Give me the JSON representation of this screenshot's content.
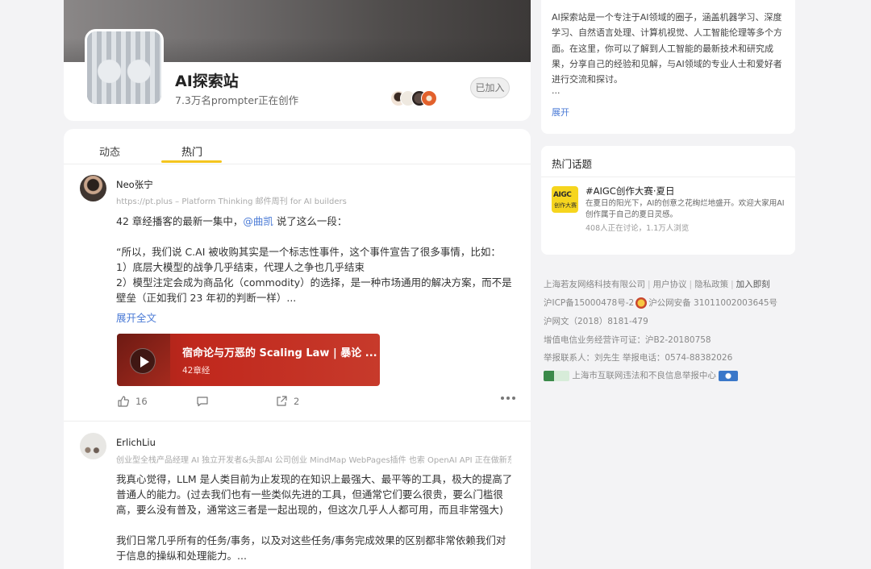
{
  "group": {
    "name": "AI探索站",
    "member_line": "7.3万名prompter正在创作",
    "joined_label": "已加入"
  },
  "tabs": [
    {
      "label": "动态"
    },
    {
      "label": "热门"
    }
  ],
  "posts": [
    {
      "author": "Neo张宁",
      "author_desc": "https://pt.plus – Platform Thinking 邮件周刊 for AI builders",
      "text_prefix": "42 章经播客的最新一集中，",
      "mention": "@曲凯",
      "text_suffix": " 说了这么一段：",
      "paragraphs": [
        "“所以，我们说 C.AI 被收购其实是一个标志性事件，这个事件宣告了很多事情，比如：",
        "1）底层大模型的战争几乎结束，代理人之争也几乎结束",
        "2）模型注定会成为商品化（commodity）的选择，是一种市场通用的解决方案，而不是壁垒（正如我们 23 年初的判断一样）..."
      ],
      "expand_label": "展开全文",
      "media": {
        "title": "宿命论与万恶的 Scaling Law | 暴论 ...",
        "subtitle": "42章经"
      },
      "likes": "16",
      "shares": "2"
    },
    {
      "author": "ErlichLiu",
      "author_desc": "创业型全栈产品经理 AI 独立开发者&头部AI 公司创业 MindMap WebPages插件 也索 OpenAI API 正在做新东...",
      "paragraphs": [
        "我真心觉得，LLM 是人类目前为止发现的在知识上最强大、最平等的工具，极大的提高了普通人的能力。(过去我们也有一些类似先进的工具，但通常它们要么很贵，要么门槛很高，要么没有普及，通常这三者是一起出现的，但这次几乎人人都可用，而且非常强大)",
        "",
        "我们日常几乎所有的任务/事务，以及对这些任务/事务完成效果的区别都非常依赖我们对于信息的操纵和处理能力。..."
      ]
    }
  ],
  "sidebar": {
    "intro": "AI探索站是一个专注于AI领域的圈子，涵盖机器学习、深度学习、自然语言处理、计算机视觉、人工智能伦理等多个方面。在这里，你可以了解到人工智能的最新技术和研究成果，分享自己的经验和见解，与AI领域的专业人士和爱好者进行交流和探讨。",
    "intro_ellipsis": "...",
    "intro_expand": "展开",
    "topics_title": "热门话题",
    "topic": {
      "icon_text_1": "AIGC",
      "icon_text_2": "创作大赛",
      "name": "#AIGC创作大赛·夏日",
      "desc": "在夏日的阳光下，AI的创意之花绚烂地盛开。欢迎大家用AI创作属于自己的夏日灵感。",
      "stats": "408人正在讨论，1.1万人浏览"
    }
  },
  "footer": {
    "company": "上海若友网络科技有限公司",
    "user_agreement": "用户协议",
    "privacy": "隐私政策",
    "join": "加入即刻",
    "icp": "沪ICP备15000478号-2",
    "police": "沪公网安备 31011002003645号",
    "culture": "沪网文（2018）8181-479",
    "telecom": "增值电信业务经营许可证：沪B2-20180758",
    "report": "举报联系人：刘先生 举报电话：0574-88382026",
    "report_center": "上海市互联网违法和不良信息举报中心"
  }
}
